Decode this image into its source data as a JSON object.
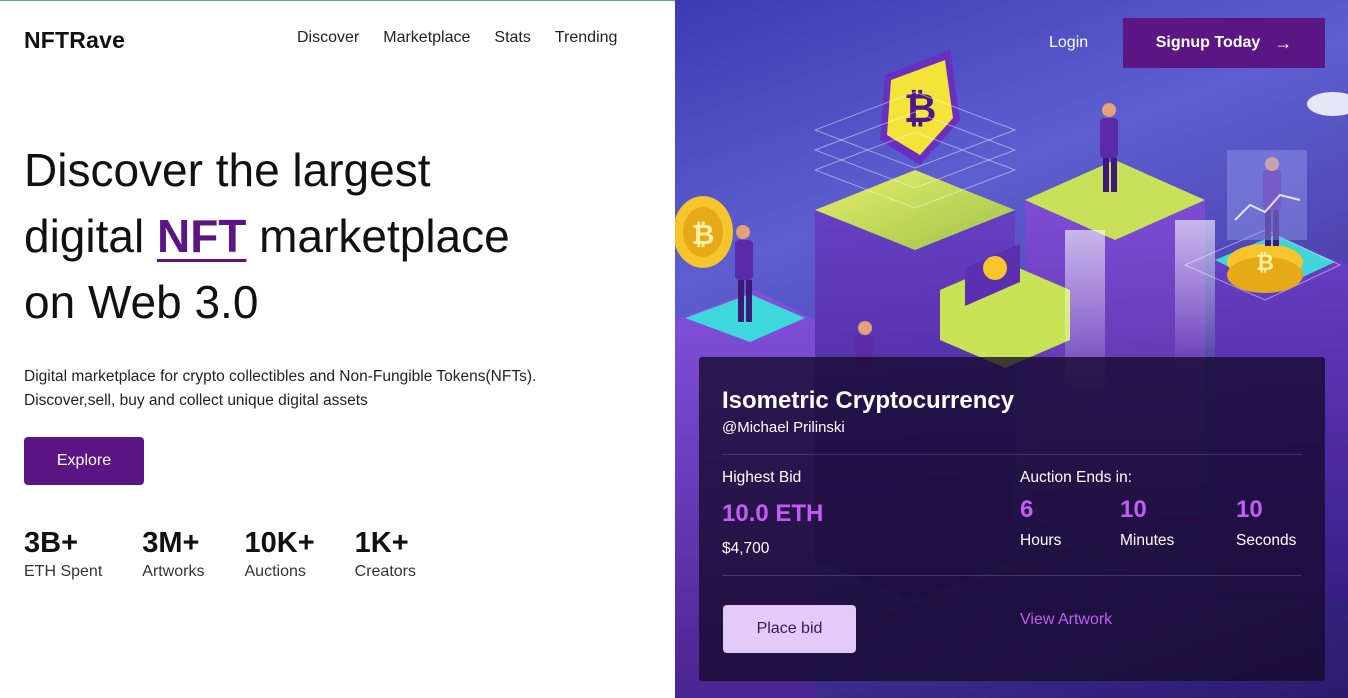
{
  "brand": {
    "logo": "NFTRave"
  },
  "nav": {
    "items": [
      "Discover",
      "Marketplace",
      "Stats",
      "Trending"
    ]
  },
  "hero": {
    "title_line1": "Discover the largest",
    "title_pre": "digital ",
    "title_accent": "NFT",
    "title_post": " marketplace",
    "title_line3": "on Web 3.0",
    "description": "Digital marketplace for crypto collectibles and Non-Fungible Tokens(NFTs). Discover,sell, buy and collect unique digital assets",
    "explore_label": "Explore"
  },
  "stats": [
    {
      "value": "3B+",
      "label": "ETH Spent"
    },
    {
      "value": "3M+",
      "label": "Artworks"
    },
    {
      "value": "10K+",
      "label": "Auctions"
    },
    {
      "value": "1K+",
      "label": "Creators"
    }
  ],
  "header_right": {
    "login_label": "Login",
    "signup_label": "Signup Today",
    "signup_icon": "arrow-right-icon"
  },
  "auction": {
    "title": "Isometric Cryptocurrency",
    "author": "@Michael Prilinski",
    "bid_label": "Highest Bid",
    "bid_value": "10.0 ETH",
    "bid_usd": "$4,700",
    "ends_label": "Auction Ends in:",
    "timer": [
      {
        "value": "6",
        "label": "Hours"
      },
      {
        "value": "10",
        "label": "Minutes"
      },
      {
        "value": "10",
        "label": "Seconds"
      }
    ],
    "place_bid_label": "Place bid",
    "view_artwork_label": "View Artwork"
  },
  "colors": {
    "brand_purple": "#5b1684",
    "accent_violet": "#c45cf5",
    "button_light": "#e4c9fb",
    "scene_blue": "#4a4ec0"
  }
}
